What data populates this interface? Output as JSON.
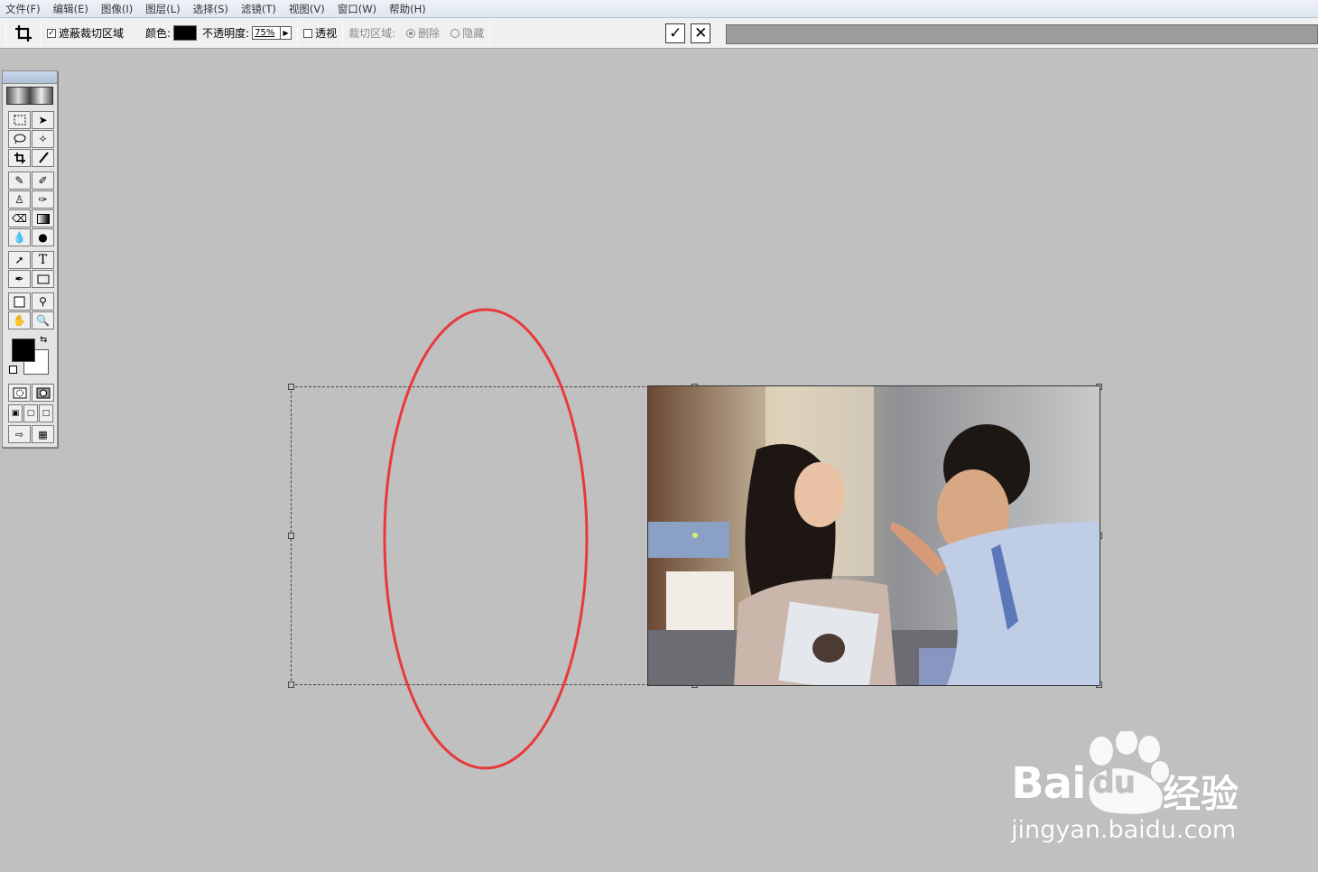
{
  "menubar": {
    "items": [
      "文件(F)",
      "编辑(E)",
      "图像(I)",
      "图层(L)",
      "选择(S)",
      "滤镜(T)",
      "视图(V)",
      "窗口(W)",
      "帮助(H)"
    ]
  },
  "options_bar": {
    "shield_label": "遮蔽裁切区域",
    "shield_checked": true,
    "color_label": "颜色:",
    "shield_color": "#000000",
    "opacity_label": "不透明度:",
    "opacity_value": "75%",
    "perspective_label": "透视",
    "perspective_checked": false,
    "cropped_area_label": "裁切区域:",
    "delete_label": "删除",
    "hide_label": "隐藏",
    "commit_symbol": "✓",
    "cancel_symbol": "✕"
  },
  "toolbox": {
    "tools": [
      [
        "rect-marquee-icon",
        "move-icon"
      ],
      [
        "lasso-icon",
        "magic-wand-icon"
      ],
      [
        "crop-icon",
        "slice-icon"
      ],
      [
        "healing-brush-icon",
        "brush-icon"
      ],
      [
        "clone-stamp-icon",
        "history-brush-icon"
      ],
      [
        "eraser-icon",
        "gradient-icon"
      ],
      [
        "blur-icon",
        "dodge-icon"
      ],
      [
        "path-select-icon",
        "type-icon"
      ],
      [
        "pen-icon",
        "rectangle-shape-icon"
      ],
      [
        "notes-icon",
        "eyedropper-icon"
      ],
      [
        "hand-icon",
        "zoom-icon"
      ]
    ],
    "foreground_color": "#000000",
    "background_color": "#ffffff",
    "type_tool_glyph": "T"
  },
  "canvas": {
    "annotation_color": "#e83a3a"
  },
  "watermark": {
    "brand": "Bai",
    "brand_du": "du",
    "product": "经验",
    "url": "jingyan.baidu.com"
  }
}
